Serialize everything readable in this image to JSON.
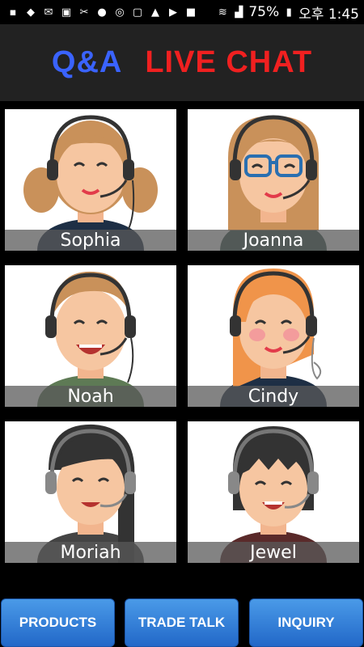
{
  "status_bar": {
    "battery": "75%",
    "time": "오후 1:45"
  },
  "header": {
    "title_left": "Q&A",
    "title_right": "LIVE CHAT"
  },
  "agents": [
    {
      "name": "Sophia"
    },
    {
      "name": "Joanna"
    },
    {
      "name": "Noah"
    },
    {
      "name": "Cindy"
    },
    {
      "name": "Moriah"
    },
    {
      "name": "Jewel"
    }
  ],
  "buttons": {
    "products": "PRODUCTS",
    "trade_talk": "TRADE TALK",
    "inquiry": "INQUIRY"
  },
  "colors": {
    "title_left": "#3a63ff",
    "title_right": "#f02020",
    "button": "#2f7fd8"
  }
}
